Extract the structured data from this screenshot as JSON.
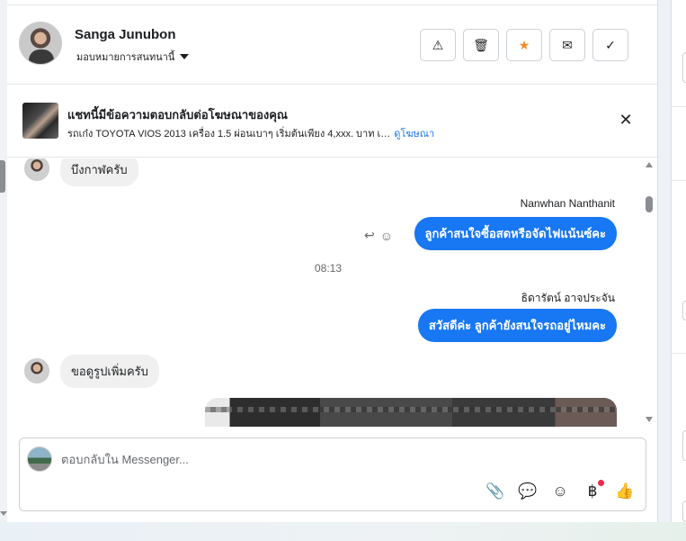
{
  "contact": {
    "name": "Sanga Junubon",
    "assign_label": "มอบหมายการสนทนานี้"
  },
  "actions": [
    {
      "icon": "warning-icon",
      "glyph": "⚠"
    },
    {
      "icon": "trash-icon",
      "glyph": "🗑"
    },
    {
      "icon": "star-icon",
      "glyph": "★"
    },
    {
      "icon": "mail-icon",
      "glyph": "✉"
    },
    {
      "icon": "check-icon",
      "glyph": "✓"
    }
  ],
  "ad": {
    "title": "แชทนี้มีข้อความตอบกลับต่อโฆษณาของคุณ",
    "description": "รถเก๋ง TOYOTA VIOS 2013 เครื่อง 1.5 ผ่อนเบาๆ เริ่มต้นเพียง 4,xxx. บาท เ…",
    "link": "ดูโฆษณา",
    "close_glyph": "✕"
  },
  "messages": {
    "m1_text": "บึงกาฬครับ",
    "m2_sender": "Nanwhan Nanthanit",
    "m2_text": "ลูกค้าสนใจซื้อสดหรือจัดไฟแน้นซ์คะ",
    "time": "08:13",
    "m3_sender": "ธิดารัตน์ อาจประจัน",
    "m3_text": "สวัสดีค่ะ ลูกค้ายังสนใจรถอยู่ไหมคะ",
    "m4_text": "ขอดูรูปเพิ่มครับ"
  },
  "composer": {
    "placeholder": "ตอบกลับใน Messenger..."
  },
  "composer_tools": [
    {
      "icon": "attachment-icon",
      "glyph": "📎"
    },
    {
      "icon": "chat-bubble-icon",
      "glyph": "💬"
    },
    {
      "icon": "emoji-icon",
      "glyph": "☺"
    },
    {
      "icon": "baht-icon",
      "glyph": "฿"
    },
    {
      "icon": "like-icon",
      "glyph": "👍"
    }
  ],
  "colors": {
    "accent": "#1877f2",
    "star": "#f28c28",
    "notification_dot": "#f02849"
  }
}
